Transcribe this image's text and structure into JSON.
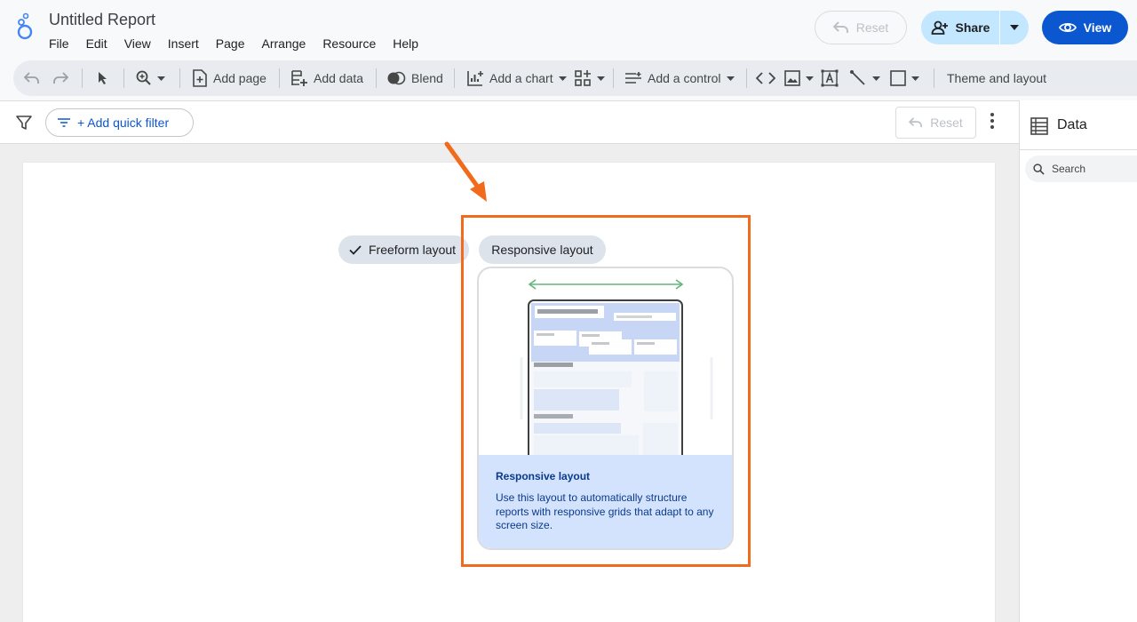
{
  "header": {
    "title": "Untitled Report",
    "menu": [
      "File",
      "Edit",
      "View",
      "Insert",
      "Page",
      "Arrange",
      "Resource",
      "Help"
    ],
    "reset_label": "Reset",
    "share_label": "Share",
    "view_label": "View"
  },
  "toolbar": {
    "add_page": "Add page",
    "add_data": "Add data",
    "blend": "Blend",
    "add_chart": "Add a chart",
    "add_control": "Add a control",
    "theme_layout": "Theme and layout"
  },
  "filterbar": {
    "quick_filter": "+ Add quick filter",
    "reset_label": "Reset"
  },
  "data_panel": {
    "title": "Data",
    "search_placeholder": "Search"
  },
  "layout_chooser": {
    "freeform_label": "Freeform layout",
    "responsive_label": "Responsive layout",
    "card_title": "Responsive layout",
    "card_description": "Use this layout to automatically structure reports with responsive grids that adapt to any screen size.",
    "selected": "Freeform layout"
  },
  "colors": {
    "accent": "#0b57d0",
    "share_bg": "#c2e7ff",
    "highlight": "#f26a1b",
    "card_footer_bg": "#d3e3fd"
  }
}
